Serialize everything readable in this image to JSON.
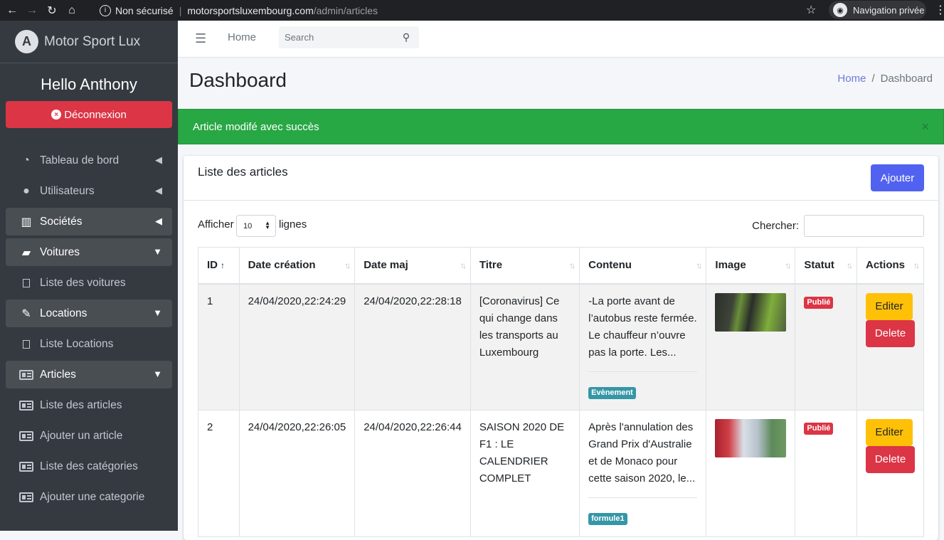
{
  "browser": {
    "security": "Non sécurisé",
    "host": "motorsportsluxembourg.com",
    "path": "/admin/articles",
    "private_label": "Navigation privée"
  },
  "sidebar": {
    "brand": "Motor Sport Lux",
    "greeting": "Hello Anthony",
    "logout_label": "Déconnexion",
    "items": [
      {
        "label": "Tableau de bord",
        "icon": "tachometer-icon"
      },
      {
        "label": "Utilisateurs",
        "icon": "user-icon"
      },
      {
        "label": "Sociétés",
        "icon": "building-icon"
      },
      {
        "label": "Voitures",
        "icon": "car-icon"
      },
      {
        "label": "Liste des voitures",
        "icon": "square-icon"
      },
      {
        "label": "Locations",
        "icon": "file-signature-icon"
      },
      {
        "label": "Liste Locations",
        "icon": "square-icon"
      },
      {
        "label": "Articles",
        "icon": "newspaper-icon"
      },
      {
        "label": "Liste des articles",
        "icon": "newspaper-icon"
      },
      {
        "label": "Ajouter un article",
        "icon": "newspaper-icon"
      },
      {
        "label": "Liste des catégories",
        "icon": "newspaper-icon"
      },
      {
        "label": "Ajouter une categorie",
        "icon": "newspaper-icon"
      }
    ]
  },
  "topnav": {
    "home_label": "Home",
    "search_placeholder": "Search"
  },
  "header": {
    "title": "Dashboard",
    "breadcrumb_home": "Home",
    "breadcrumb_current": "Dashboard"
  },
  "alert": {
    "message": "Article modifé avec succès",
    "close": "×"
  },
  "card": {
    "title": "Liste des articles",
    "add_label": "Ajouter",
    "show_label": "Afficher",
    "entries_value": "10",
    "lines_label": "lignes",
    "search_label": "Chercher:"
  },
  "table": {
    "columns": [
      "ID",
      "Date création",
      "Date maj",
      "Titre",
      "Contenu",
      "Image",
      "Statut",
      "Actions"
    ],
    "rows": [
      {
        "id": "1",
        "created": "24/04/2020,22:24:29",
        "updated": "24/04/2020,22:28:18",
        "title": "[Coronavirus] Ce qui change dans les transports au Luxembourg",
        "content": "-La porte avant de l’autobus reste fermée. Le chauffeur n’ouvre pas la porte. Les...",
        "category": "Evènement",
        "status": "Publié",
        "edit_label": "Editer",
        "delete_label": "Delete"
      },
      {
        "id": "2",
        "created": "24/04/2020,22:26:05",
        "updated": "24/04/2020,22:26:44",
        "title": "SAISON 2020 DE F1 : LE CALENDRIER COMPLET",
        "content": "Après l'annulation des Grand Prix d'Australie et de Monaco pour cette saison 2020, le...",
        "category": "formule1",
        "status": "Publié",
        "edit_label": "Editer",
        "delete_label": "Delete"
      }
    ]
  }
}
